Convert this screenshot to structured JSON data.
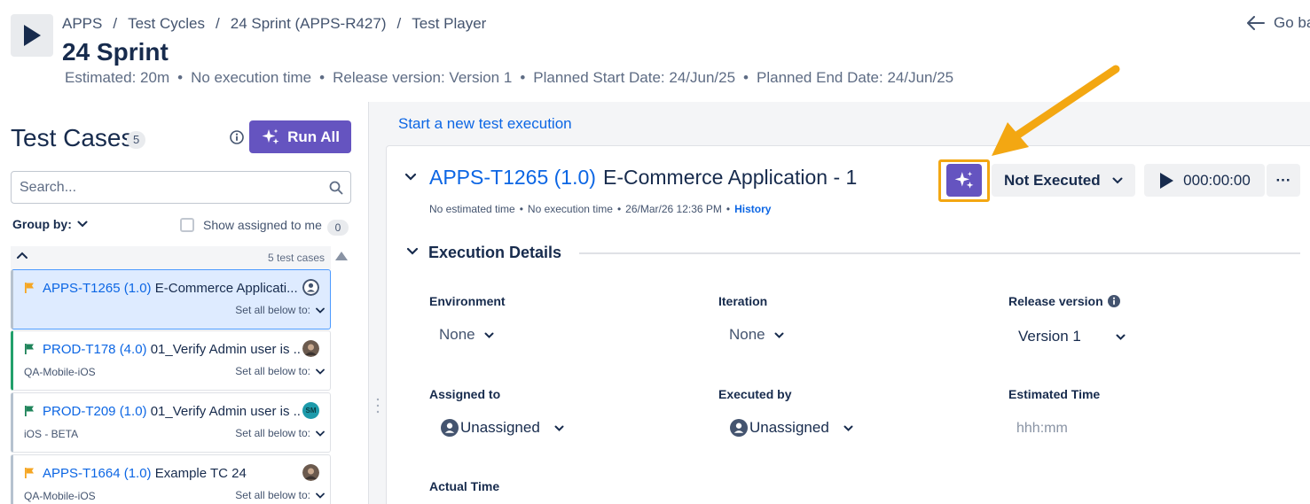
{
  "header": {
    "breadcrumbs": [
      "APPS",
      "Test Cycles",
      "24 Sprint (APPS-R427)",
      "Test Player"
    ],
    "breadcrumb_sep": "/",
    "title": "24 Sprint",
    "meta": {
      "estimated": "Estimated: 20m",
      "execution_time": "No execution time",
      "release": "Release version: Version 1",
      "planned_start": "Planned Start Date: 24/Jun/25",
      "planned_end": "Planned End Date: 24/Jun/25",
      "separator": "•"
    },
    "go_back": "Go ba"
  },
  "left_panel": {
    "title": "Test Cases",
    "count": "5",
    "run_all": "Run All",
    "search_placeholder": "Search...",
    "group_by": "Group by:",
    "show_assigned": "Show assigned to me",
    "assigned_count": "0",
    "cases_summary": "5 test cases",
    "set_all_label": "Set all below to:",
    "items": [
      {
        "key": "APPS-T1265 (1.0)",
        "name": "E-Commerce Applicati...",
        "sub": "",
        "flag": "orange",
        "avatar": "default",
        "selected": true
      },
      {
        "key": "PROD-T178 (4.0)",
        "name": "01_Verify Admin user is ...",
        "sub": "QA-Mobile-iOS",
        "flag": "green",
        "avatar": "photo",
        "selected": false
      },
      {
        "key": "PROD-T209 (1.0)",
        "name": "01_Verify Admin user is ...",
        "sub": "iOS - BETA",
        "flag": "green",
        "avatar": "initials",
        "initials": "SM",
        "selected": false
      },
      {
        "key": "APPS-T1664 (1.0)",
        "name": "Example TC 24",
        "sub": "QA-Mobile-iOS",
        "flag": "orange",
        "avatar": "photo",
        "selected": false
      }
    ]
  },
  "right_panel": {
    "start_new": "Start a new test execution",
    "execution": {
      "key": "APPS-T1265 (1.0)",
      "name": "E-Commerce Application - 1",
      "estimated": "No estimated time",
      "exec_time": "No execution time",
      "date": "26/Mar/26 12:36 PM",
      "history": "History",
      "separator": "•",
      "status": "Not Executed",
      "timer": "000:00:00",
      "more": "···"
    },
    "details_title": "Execution Details",
    "fields": {
      "environment_label": "Environment",
      "environment_value": "None",
      "iteration_label": "Iteration",
      "iteration_value": "None",
      "release_label": "Release version",
      "release_value": "Version 1",
      "assigned_label": "Assigned to",
      "assigned_value": "Unassigned",
      "executed_label": "Executed by",
      "executed_value": "Unassigned",
      "estimated_label": "Estimated Time",
      "estimated_placeholder": "hhh:mm",
      "actual_label": "Actual Time"
    }
  },
  "colors": {
    "accent_purple": "#6554c0",
    "link_blue": "#0c66e4",
    "annotation_orange": "#f3a712",
    "flag_orange": "#f5a623",
    "flag_green": "#1f845a"
  },
  "icons": [
    "play-icon",
    "arrow-left-icon",
    "info-icon",
    "sparkle-icon",
    "search-icon",
    "chevron-down-icon",
    "chevron-up-icon",
    "flag-icon",
    "avatar-icon",
    "user-icon"
  ]
}
